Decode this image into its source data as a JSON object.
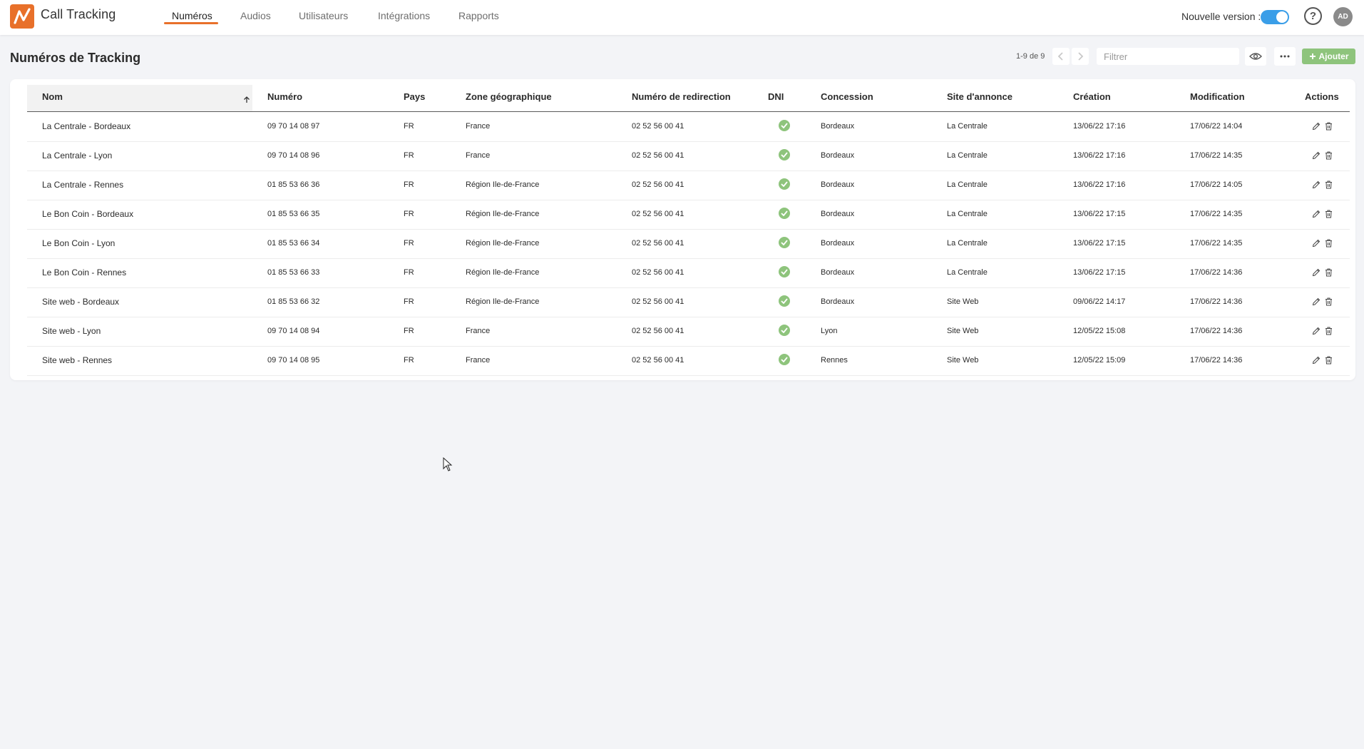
{
  "app": {
    "title": "Call Tracking",
    "nav": [
      {
        "label": "Numéros",
        "active": true
      },
      {
        "label": "Audios",
        "active": false
      },
      {
        "label": "Utilisateurs",
        "active": false
      },
      {
        "label": "Intégrations",
        "active": false
      },
      {
        "label": "Rapports",
        "active": false
      }
    ],
    "version_label": "Nouvelle version :",
    "version_toggle_on": true,
    "help_label": "?",
    "avatar_initials": "AD",
    "accent_color": "#e8702a",
    "toggle_color": "#3a9ee8",
    "success_color": "#8ec47c"
  },
  "page": {
    "title": "Numéros de Tracking",
    "pagination": "1-9 de 9",
    "filter_placeholder": "Filtrer",
    "add_label": "Ajouter"
  },
  "table": {
    "columns": [
      "Nom",
      "Numéro",
      "Pays",
      "Zone géographique",
      "Numéro de redirection",
      "DNI",
      "Concession",
      "Site d'annonce",
      "Création",
      "Modification",
      "Actions"
    ],
    "sort": {
      "column": "Nom",
      "direction": "asc"
    },
    "rows": [
      {
        "nom": "La Centrale - Bordeaux",
        "numero": "09 70 14 08 97",
        "pays": "FR",
        "zone": "France",
        "redirection": "02 52 56 00 41",
        "dni": true,
        "concession": "Bordeaux",
        "site": "La Centrale",
        "creation": "13/06/22 17:16",
        "modification": "17/06/22 14:04"
      },
      {
        "nom": "La Centrale - Lyon",
        "numero": "09 70 14 08 96",
        "pays": "FR",
        "zone": "France",
        "redirection": "02 52 56 00 41",
        "dni": true,
        "concession": "Bordeaux",
        "site": "La Centrale",
        "creation": "13/06/22 17:16",
        "modification": "17/06/22 14:35"
      },
      {
        "nom": "La Centrale - Rennes",
        "numero": "01 85 53 66 36",
        "pays": "FR",
        "zone": "Région Ile-de-France",
        "redirection": "02 52 56 00 41",
        "dni": true,
        "concession": "Bordeaux",
        "site": "La Centrale",
        "creation": "13/06/22 17:16",
        "modification": "17/06/22 14:05"
      },
      {
        "nom": "Le Bon Coin - Bordeaux",
        "numero": "01 85 53 66 35",
        "pays": "FR",
        "zone": "Région Ile-de-France",
        "redirection": "02 52 56 00 41",
        "dni": true,
        "concession": "Bordeaux",
        "site": "La Centrale",
        "creation": "13/06/22 17:15",
        "modification": "17/06/22 14:35"
      },
      {
        "nom": "Le Bon Coin - Lyon",
        "numero": "01 85 53 66 34",
        "pays": "FR",
        "zone": "Région Ile-de-France",
        "redirection": "02 52 56 00 41",
        "dni": true,
        "concession": "Bordeaux",
        "site": "La Centrale",
        "creation": "13/06/22 17:15",
        "modification": "17/06/22 14:35"
      },
      {
        "nom": "Le Bon Coin - Rennes",
        "numero": "01 85 53 66 33",
        "pays": "FR",
        "zone": "Région Ile-de-France",
        "redirection": "02 52 56 00 41",
        "dni": true,
        "concession": "Bordeaux",
        "site": "La Centrale",
        "creation": "13/06/22 17:15",
        "modification": "17/06/22 14:36"
      },
      {
        "nom": "Site web - Bordeaux",
        "numero": "01 85 53 66 32",
        "pays": "FR",
        "zone": "Région Ile-de-France",
        "redirection": "02 52 56 00 41",
        "dni": true,
        "concession": "Bordeaux",
        "site": "Site Web",
        "creation": "09/06/22 14:17",
        "modification": "17/06/22 14:36"
      },
      {
        "nom": "Site web - Lyon",
        "numero": "09 70 14 08 94",
        "pays": "FR",
        "zone": "France",
        "redirection": "02 52 56 00 41",
        "dni": true,
        "concession": "Lyon",
        "site": "Site Web",
        "creation": "12/05/22 15:08",
        "modification": "17/06/22 14:36"
      },
      {
        "nom": "Site web - Rennes",
        "numero": "09 70 14 08 95",
        "pays": "FR",
        "zone": "France",
        "redirection": "02 52 56 00 41",
        "dni": true,
        "concession": "Rennes",
        "site": "Site Web",
        "creation": "12/05/22 15:09",
        "modification": "17/06/22 14:36"
      }
    ]
  }
}
